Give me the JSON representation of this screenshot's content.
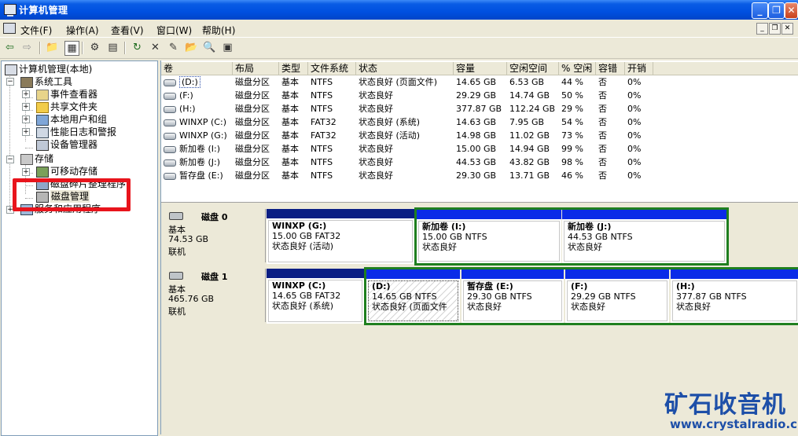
{
  "window": {
    "title": "计算机管理"
  },
  "menu": [
    "文件(F)",
    "操作(A)",
    "查看(V)",
    "窗口(W)",
    "帮助(H)"
  ],
  "tree": {
    "root": "计算机管理(本地)",
    "system_tools": "系统工具",
    "event_viewer": "事件查看器",
    "shared_folders": "共享文件夹",
    "local_users": "本地用户和组",
    "perf_logs": "性能日志和警报",
    "device_manager": "设备管理器",
    "storage": "存储",
    "removable_storage": "可移动存储",
    "defrag": "磁盘碎片整理程序",
    "disk_management": "磁盘管理",
    "services_apps": "服务和应用程序"
  },
  "volume_table": {
    "headers": [
      "卷",
      "布局",
      "类型",
      "文件系统",
      "状态",
      "容量",
      "空闲空间",
      "% 空闲",
      "容错",
      "开销"
    ],
    "rows": [
      [
        "(D:)",
        "磁盘分区",
        "基本",
        "NTFS",
        "状态良好 (页面文件)",
        "14.65 GB",
        "6.53 GB",
        "44 %",
        "否",
        "0%"
      ],
      [
        "(F:)",
        "磁盘分区",
        "基本",
        "NTFS",
        "状态良好",
        "29.29 GB",
        "14.74 GB",
        "50 %",
        "否",
        "0%"
      ],
      [
        "(H:)",
        "磁盘分区",
        "基本",
        "NTFS",
        "状态良好",
        "377.87 GB",
        "112.24 GB",
        "29 %",
        "否",
        "0%"
      ],
      [
        "WINXP (C:)",
        "磁盘分区",
        "基本",
        "FAT32",
        "状态良好 (系统)",
        "14.63 GB",
        "7.95 GB",
        "54 %",
        "否",
        "0%"
      ],
      [
        "WINXP (G:)",
        "磁盘分区",
        "基本",
        "FAT32",
        "状态良好 (活动)",
        "14.98 GB",
        "11.02 GB",
        "73 %",
        "否",
        "0%"
      ],
      [
        "新加卷 (I:)",
        "磁盘分区",
        "基本",
        "NTFS",
        "状态良好",
        "15.00 GB",
        "14.94 GB",
        "99 %",
        "否",
        "0%"
      ],
      [
        "新加卷 (J:)",
        "磁盘分区",
        "基本",
        "NTFS",
        "状态良好",
        "44.53 GB",
        "43.82 GB",
        "98 %",
        "否",
        "0%"
      ],
      [
        "暂存盘 (E:)",
        "磁盘分区",
        "基本",
        "NTFS",
        "状态良好",
        "29.30 GB",
        "13.71 GB",
        "46 %",
        "否",
        "0%"
      ]
    ]
  },
  "disks": [
    {
      "name": "磁盘 0",
      "type": "基本",
      "size": "74.53 GB",
      "status": "联机",
      "partitions": [
        {
          "name": "WINXP  (G:)",
          "info": "15.00 GB FAT32",
          "status": "状态良好 (活动)"
        },
        {
          "name": "新加卷  (I:)",
          "info": "15.00 GB NTFS",
          "status": "状态良好"
        },
        {
          "name": "新加卷  (J:)",
          "info": "44.53 GB NTFS",
          "status": "状态良好"
        }
      ]
    },
    {
      "name": "磁盘 1",
      "type": "基本",
      "size": "465.76 GB",
      "status": "联机",
      "partitions": [
        {
          "name": "WINXP  (C:)",
          "info": "14.65 GB FAT32",
          "status": "状态良好 (系统)"
        },
        {
          "name": "(D:)",
          "info": "14.65 GB NTFS",
          "status": "状态良好 (页面文件"
        },
        {
          "name": "暂存盘  (E:)",
          "info": "29.30 GB NTFS",
          "status": "状态良好"
        },
        {
          "name": "(F:)",
          "info": "29.29 GB NTFS",
          "status": "状态良好"
        },
        {
          "name": "(H:)",
          "info": "377.87 GB NTFS",
          "status": "状态良好"
        }
      ]
    }
  ],
  "watermark": {
    "cn": "矿石收音机",
    "url": "www.crystalradio.cn"
  },
  "colors": {
    "primary_bar": "#0a1e84",
    "logical_bar": "#0a2be8",
    "extended_border": "#1f7f1f",
    "highlight": "#e8141c"
  }
}
